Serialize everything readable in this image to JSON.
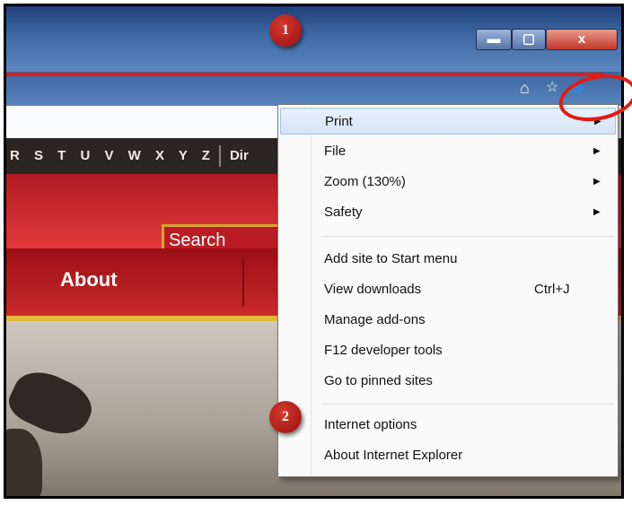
{
  "window": {
    "minimize_icon": "minimize-icon",
    "maximize_icon": "maximize-icon",
    "close_icon": "close-icon",
    "close_glyph": "x"
  },
  "toolbar": {
    "icons": [
      "home-icon",
      "favorites-star-icon",
      "tools-gear-icon"
    ]
  },
  "page": {
    "alphabet": "R S T U V W X Y Z",
    "directory_partial": "Dir",
    "search_placeholder": "Search",
    "nav_about": "About"
  },
  "tools_menu": {
    "items": [
      {
        "label": "Print",
        "submenu": true,
        "highlighted": true
      },
      {
        "label": "File",
        "submenu": true
      },
      {
        "label": "Zoom (130%)",
        "submenu": true
      },
      {
        "label": "Safety",
        "submenu": true
      },
      {
        "label": "Add site to Start menu"
      },
      {
        "label": "View downloads",
        "shortcut": "Ctrl+J"
      },
      {
        "label": "Manage add-ons"
      },
      {
        "label": "F12 developer tools"
      },
      {
        "label": "Go to pinned sites"
      },
      {
        "label": "Internet options"
      },
      {
        "label": "About Internet Explorer"
      }
    ]
  },
  "annotations": {
    "step1": "1",
    "step2": "2",
    "highlight_color": "#e31b13"
  }
}
